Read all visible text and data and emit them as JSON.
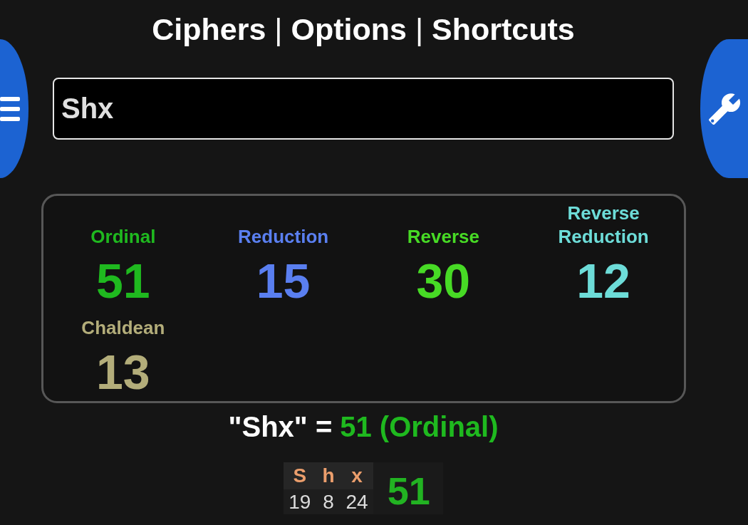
{
  "nav": [
    {
      "kind": "link",
      "label": "Ciphers"
    },
    {
      "kind": "separator",
      "label": "|"
    },
    {
      "kind": "link",
      "label": "Options"
    },
    {
      "kind": "separator",
      "label": "|"
    },
    {
      "kind": "link",
      "label": "Shortcuts"
    }
  ],
  "search": {
    "value": "Shx"
  },
  "ciphers": [
    {
      "name": "Ordinal",
      "value": "51",
      "color": "#1fb91f"
    },
    {
      "name": "Reduction",
      "value": "15",
      "color": "#5a7ff0"
    },
    {
      "name": "Reverse",
      "value": "30",
      "color": "#47da25"
    },
    {
      "name": "Reverse Reduction",
      "value": "12",
      "color": "#6ddcd8"
    },
    {
      "name": "Chaldean",
      "value": "13",
      "color": "#b3ad7a"
    }
  ],
  "summary": {
    "phrase": "\"Shx\" =",
    "result": "51 (Ordinal)"
  },
  "breakdown": {
    "letters": [
      {
        "letter": "S",
        "value": "19"
      },
      {
        "letter": "h",
        "value": "8"
      },
      {
        "letter": "x",
        "value": "24"
      }
    ],
    "total": "51"
  }
}
